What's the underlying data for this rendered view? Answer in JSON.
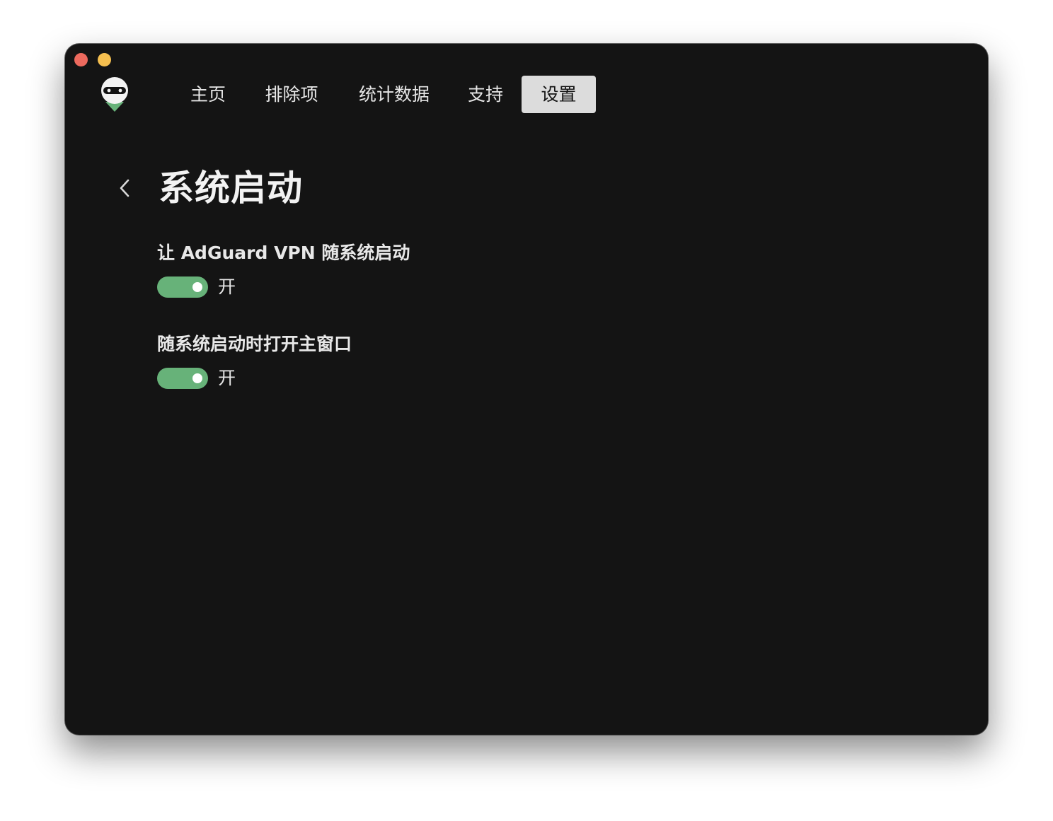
{
  "window": {
    "controls": [
      "close",
      "minimize"
    ]
  },
  "colors": {
    "background": "#141414",
    "accent": "#67b279",
    "active_tab_bg": "#dcdcdc",
    "text": "#e6e6e6"
  },
  "logo": {
    "icon": "adguard-robot-logo-icon"
  },
  "nav": {
    "items": [
      {
        "label": "主页",
        "active": false
      },
      {
        "label": "排除项",
        "active": false
      },
      {
        "label": "统计数据",
        "active": false
      },
      {
        "label": "支持",
        "active": false
      },
      {
        "label": "设置",
        "active": true
      }
    ]
  },
  "page": {
    "back_icon": "chevron-left-icon",
    "title": "系统启动"
  },
  "settings": [
    {
      "label": "让 AdGuard VPN 随系统启动",
      "enabled": true,
      "state_text": "开"
    },
    {
      "label": "随系统启动时打开主窗口",
      "enabled": true,
      "state_text": "开"
    }
  ]
}
